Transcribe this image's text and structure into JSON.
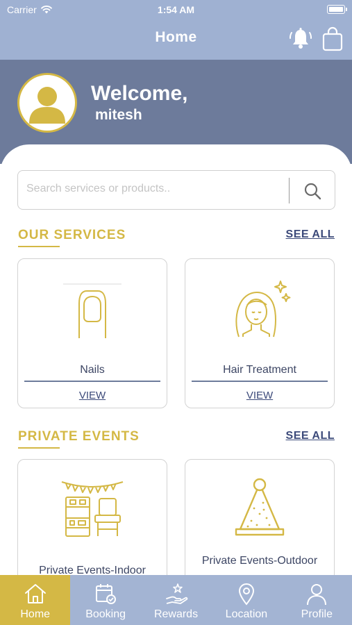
{
  "status_bar": {
    "carrier": "Carrier",
    "time": "1:54 AM"
  },
  "header": {
    "title": "Home",
    "icons": [
      "bell-icon",
      "shopping-bag-icon"
    ]
  },
  "welcome": {
    "greeting": "Welcome,",
    "name": "mitesh"
  },
  "search": {
    "placeholder": "Search services or products..",
    "value": ""
  },
  "services": {
    "title": "OUR SERVICES",
    "see_all": "SEE ALL",
    "items": [
      {
        "label": "Nails",
        "view": "VIEW",
        "icon": "nail-icon"
      },
      {
        "label": "Hair Treatment",
        "view": "VIEW",
        "icon": "hair-treatment-icon"
      }
    ]
  },
  "events": {
    "title": "PRIVATE EVENTS",
    "see_all": "SEE ALL",
    "items": [
      {
        "label": "Private Events-Indoor",
        "icon": "indoor-party-icon"
      },
      {
        "label": "Private Events-Outdoor",
        "icon": "party-hat-icon"
      }
    ]
  },
  "tabs": [
    {
      "label": "Home",
      "icon": "home-icon",
      "active": true
    },
    {
      "label": "Booking",
      "icon": "calendar-icon",
      "active": false
    },
    {
      "label": "Rewards",
      "icon": "rewards-icon",
      "active": false
    },
    {
      "label": "Location",
      "icon": "location-pin-icon",
      "active": false
    },
    {
      "label": "Profile",
      "icon": "user-icon",
      "active": false
    }
  ],
  "colors": {
    "header": "#9fb1d2",
    "welcome_band": "#6d7b9b",
    "accent_gold": "#d4b845",
    "link_navy": "#3c4a7a",
    "tab_bar": "#a3b4d3"
  }
}
